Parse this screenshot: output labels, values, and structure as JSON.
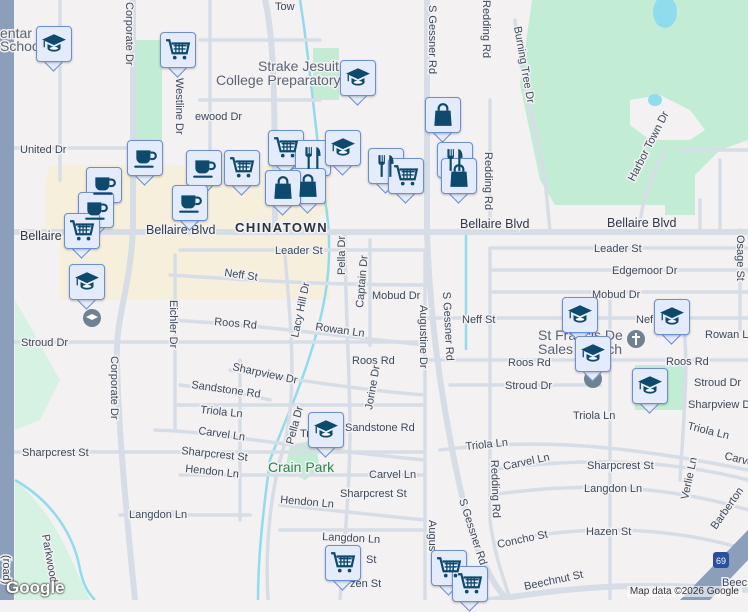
{
  "map": {
    "district": "CHINATOWN",
    "pois": {
      "strake1": "Strake Jesuit",
      "strake2": "College Preparatory",
      "school_frag1": "entar",
      "school_frag2": "Schoo",
      "st_francis1": "St Francis De",
      "st_francis2": "Sales Church",
      "park": "Crain Park"
    },
    "streets": {
      "bellaire_w": "Bellaire Blvd",
      "bellaire_m": "Bellaire Blvd",
      "bellaire_e1": "Bellaire Blvd",
      "bellaire_e2": "Bellaire Blvd",
      "corporate_n": "Corporate Dr",
      "corporate_s": "Corporate Dr",
      "westline": "Westline Dr",
      "united": "United Dr",
      "leader_w": "Leader St",
      "leader_e": "Leader St",
      "neff_w": "Neff St",
      "neff_e": "Neff St",
      "neff_far": "Nef",
      "pella_n": "Pella Dr",
      "pella_s": "Pella Dr",
      "captain": "Captain Dr",
      "mobud_w": "Mobud Dr",
      "mobud_e": "Mobud Dr",
      "lacy_hill": "Lacy Hill Dr",
      "eichler": "Eichler Dr",
      "roos_w": "Roos Rd",
      "roos_m": "Roos Rd",
      "roos_e1": "Roos Rd",
      "roos_e2": "Roos Rd",
      "rowan_w": "Rowan Ln",
      "rowan_e": "Rowan Ln",
      "stroud_w": "Stroud Dr",
      "stroud_m": "Stroud Dr",
      "stroud_e": "Stroud Dr",
      "sharpview_w": "Sharpview Dr",
      "sharpview_e": "Sharpview Dr",
      "sandstone_w": "Sandstone Rd",
      "sandstone_e": "Sandstone Rd",
      "triola_w": "Triola Ln",
      "triola_m": "Triola Ln",
      "triola_e1": "Triola Ln",
      "triola_e2": "Triola Ln",
      "triola_pk": "Tri",
      "carvel_w": "Carvel Ln",
      "carvel_m": "Carvel Ln",
      "carvel_e1": "Carvel Ln",
      "carvel_e2": "Carvel Ln",
      "sharpcrest_w": "Sharpcrest St",
      "sharpcrest_m": "Sharpcrest St",
      "sharpcrest_e": "Sharpcrest St",
      "hendon_w": "Hendon Ln",
      "hendon_m": "Hendon Ln",
      "langdon_w": "Langdon Ln",
      "langdon_m": "Langdon Ln",
      "langdon_e": "Langdon Ln",
      "jorine": "Jorine Dr",
      "augustine_n": "Augustine Dr",
      "augustine_s": "Augus",
      "gessner_n": "S Gessner Rd",
      "gessner_m": "S Gessner Rd",
      "gessner_s": "S Gessner Rd",
      "redding_n": "Redding Rd",
      "redding_m": "Redding Rd",
      "redding_s": "Redding Rd",
      "burning_tree": "Burning Tree Dr",
      "harbor_town": "Harbor Town Dr",
      "edgemoor": "Edgemoor Dr",
      "osage": "Osage St",
      "concho": "Concho St",
      "hazen_e": "Hazen St",
      "hazen_w": "zen St",
      "st_frag": "St",
      "beechnut": "Beechnut St",
      "beech_frag": "Beec",
      "verlie": "Verlie Ln",
      "barberton": "Barberton",
      "parkwood": "Parkwood",
      "hollow_road": "(road)",
      "ewood": "ewood Dr",
      "tow": "Tow",
      "i69": "69"
    },
    "attribution": "Map data ©2026 Google",
    "logo": "Google"
  },
  "colors": {
    "background": "#f3f1f2",
    "park": "#c3ecd4",
    "chinatown": "#f6efdc",
    "water": "#8fdcef",
    "highway": "#8b9fbb",
    "marker_fill": "#e4ebfb",
    "marker_icon": "#0c4a6e"
  }
}
